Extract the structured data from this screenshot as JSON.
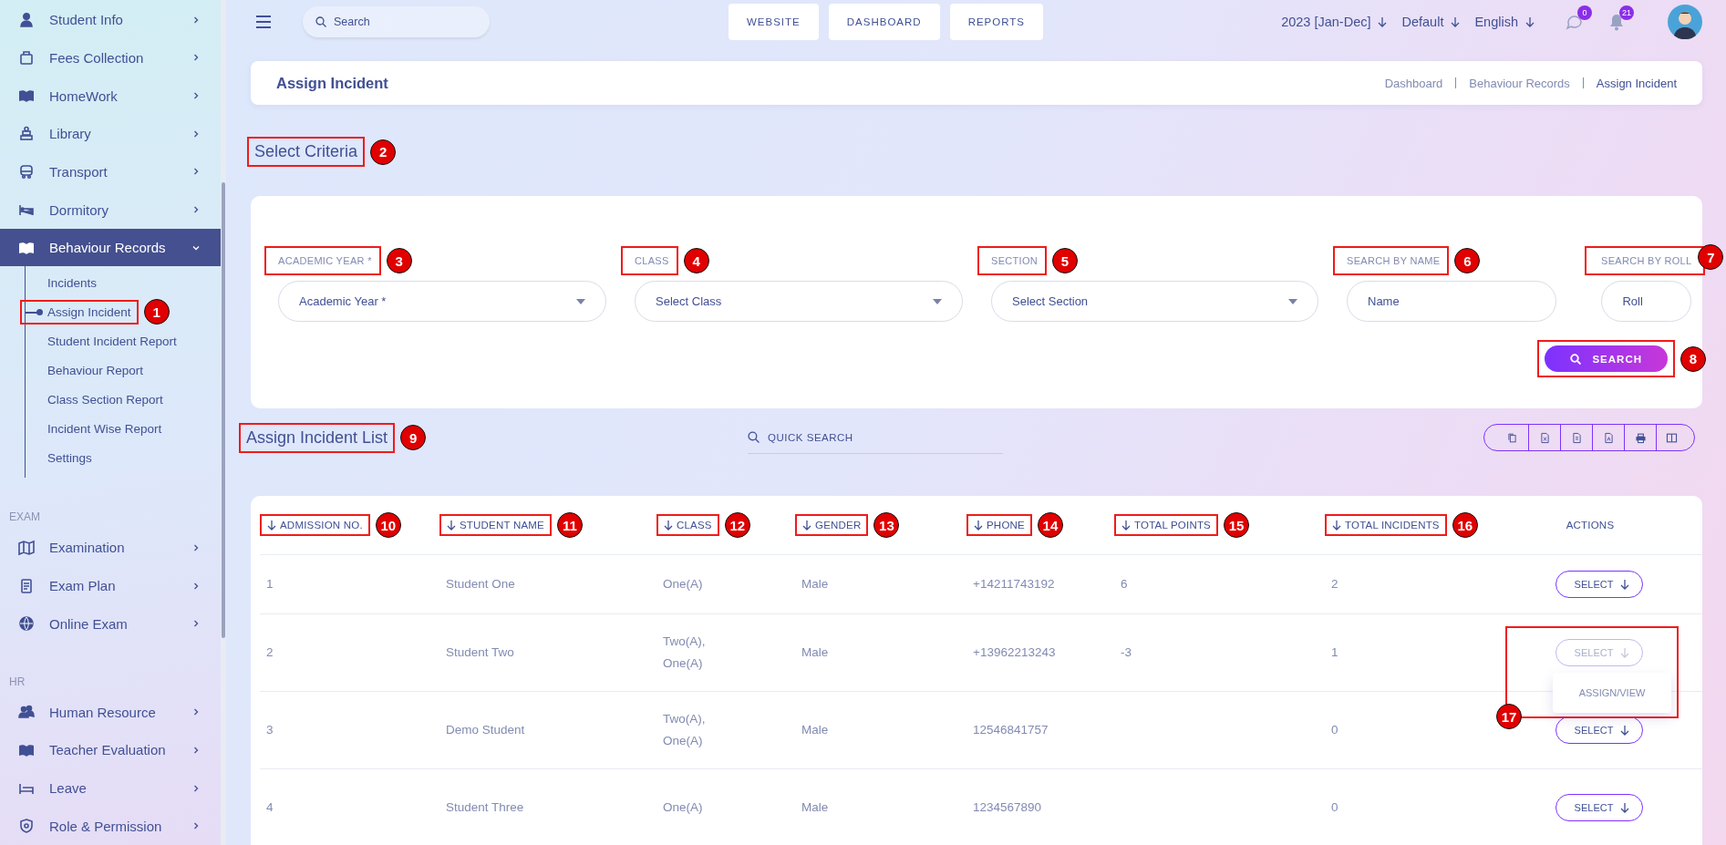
{
  "sidebar": {
    "items": [
      {
        "kind": "menu",
        "label": "Student Info",
        "expanded": false
      },
      {
        "kind": "menu",
        "label": "Fees Collection",
        "expanded": false
      },
      {
        "kind": "menu",
        "label": "HomeWork",
        "expanded": false
      },
      {
        "kind": "menu",
        "label": "Library",
        "expanded": false
      },
      {
        "kind": "menu",
        "label": "Transport",
        "expanded": false
      },
      {
        "kind": "menu",
        "label": "Dormitory",
        "expanded": false
      },
      {
        "kind": "menu",
        "label": "Behaviour Records",
        "expanded": true,
        "children": [
          {
            "label": "Incidents",
            "selected": false
          },
          {
            "label": "Assign Incident",
            "selected": true,
            "callout": "1"
          },
          {
            "label": "Student Incident Report",
            "selected": false
          },
          {
            "label": "Behaviour Report",
            "selected": false
          },
          {
            "label": "Class Section Report",
            "selected": false
          },
          {
            "label": "Incident Wise Report",
            "selected": false
          },
          {
            "label": "Settings",
            "selected": false
          }
        ]
      },
      {
        "kind": "section",
        "label": "EXAM"
      },
      {
        "kind": "menu",
        "label": "Examination",
        "expanded": false
      },
      {
        "kind": "menu",
        "label": "Exam Plan",
        "expanded": false
      },
      {
        "kind": "menu",
        "label": "Online Exam",
        "expanded": false
      },
      {
        "kind": "section",
        "label": "HR"
      },
      {
        "kind": "menu",
        "label": "Human Resource",
        "expanded": false
      },
      {
        "kind": "menu",
        "label": "Teacher Evaluation",
        "expanded": false
      },
      {
        "kind": "menu",
        "label": "Leave",
        "expanded": false
      },
      {
        "kind": "menu",
        "label": "Role & Permission",
        "expanded": false
      }
    ]
  },
  "top_bar": {
    "search": {
      "placeholder": "Search"
    },
    "nav_buttons": [
      "WEBSITE",
      "DASHBOARD",
      "REPORTS"
    ],
    "selectors": [
      "2023 [Jan-Dec]",
      "Default",
      "English"
    ],
    "notifications": [
      {
        "count": "0"
      },
      {
        "count": "21"
      }
    ]
  },
  "page_header": {
    "title": "Assign Incident",
    "breadcrumbs": [
      {
        "label": "Dashboard",
        "current": false
      },
      {
        "label": "Behaviour Records",
        "current": false
      },
      {
        "label": "Assign Incident",
        "current": true
      }
    ]
  },
  "criteria": {
    "heading": "Select Criteria",
    "callout": "2",
    "fields": [
      {
        "kind": "select",
        "label": "ACADEMIC YEAR *",
        "placeholder": "Academic Year *",
        "callout": "3"
      },
      {
        "kind": "select",
        "label": "CLASS",
        "placeholder": "Select Class",
        "callout": "4"
      },
      {
        "kind": "select",
        "label": "SECTION",
        "placeholder": "Select Section",
        "callout": "5"
      },
      {
        "kind": "text",
        "label": "SEARCH BY NAME",
        "placeholder": "Name",
        "callout": "6"
      },
      {
        "kind": "text",
        "label": "SEARCH BY ROLL",
        "placeholder": "Roll",
        "callout": "7"
      }
    ],
    "search_button": {
      "label": "SEARCH",
      "callout": "8"
    }
  },
  "list": {
    "heading": "Assign Incident List",
    "callout": "9",
    "quick_search": {
      "placeholder": "QUICK SEARCH"
    },
    "table": {
      "columns": [
        {
          "label": "ADMISSION NO.",
          "sortable": true,
          "callout": "10"
        },
        {
          "label": "STUDENT NAME",
          "sortable": true,
          "callout": "11"
        },
        {
          "label": "CLASS",
          "sortable": true,
          "callout": "12"
        },
        {
          "label": "GENDER",
          "sortable": true,
          "callout": "13"
        },
        {
          "label": "PHONE",
          "sortable": true,
          "callout": "14"
        },
        {
          "label": "TOTAL POINTS",
          "sortable": true,
          "callout": "15"
        },
        {
          "label": "TOTAL INCIDENTS",
          "sortable": true,
          "callout": "16"
        },
        {
          "label": "ACTIONS",
          "sortable": false
        }
      ],
      "rows": [
        {
          "admission_no": "1",
          "student_name": "Student One",
          "class": "One(A)",
          "gender": "Male",
          "phone": "+14211743192",
          "total_points": "6",
          "total_incidents": "2",
          "action": {
            "label": "SELECT",
            "open": false
          }
        },
        {
          "admission_no": "2",
          "student_name": "Student Two",
          "class": "Two(A),\nOne(A)",
          "gender": "Male",
          "phone": "+13962213243",
          "total_points": "-3",
          "total_incidents": "1",
          "action": {
            "label": "SELECT",
            "open": true,
            "menu": [
              "ASSIGN/VIEW"
            ],
            "callout": "17"
          }
        },
        {
          "admission_no": "3",
          "student_name": "Demo Student",
          "class": "Two(A),\nOne(A)",
          "gender": "Male",
          "phone": "12546841757",
          "total_incidents": "0",
          "action": {
            "label": "SELECT",
            "open": false
          }
        },
        {
          "admission_no": "4",
          "student_name": "Student Three",
          "class": "One(A)",
          "gender": "Male",
          "phone": "1234567890",
          "total_incidents": "0",
          "action": {
            "label": "SELECT",
            "open": false
          }
        }
      ]
    }
  }
}
